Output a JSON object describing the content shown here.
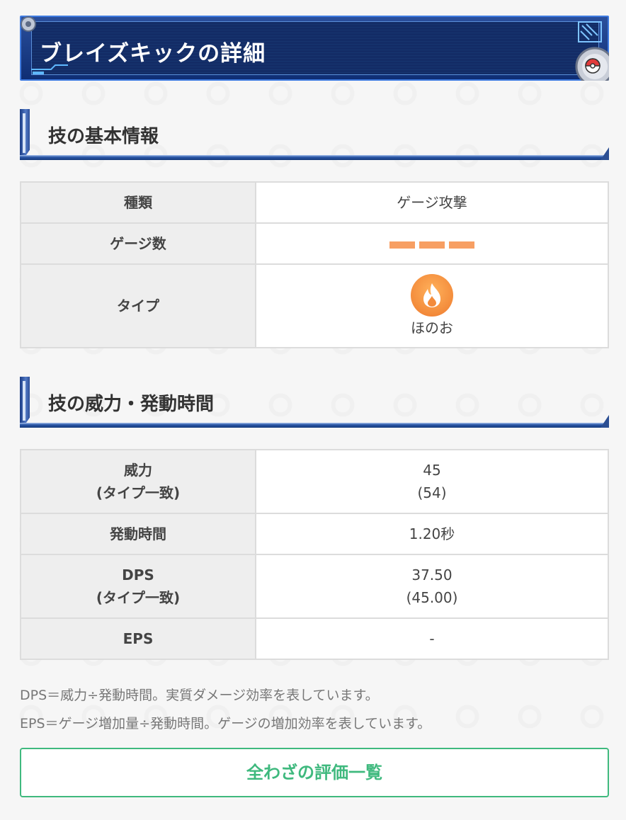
{
  "page_title": "ブレイズキックの詳細",
  "sections": {
    "basic": {
      "heading": "技の基本情報",
      "rows": {
        "kind_label": "種類",
        "kind_value": "ゲージ攻撃",
        "gauge_label": "ゲージ数",
        "gauge_count": 3,
        "gauge_color": "#f79f63",
        "type_label": "タイプ",
        "type_icon": "fire-icon",
        "type_value": "ほのお"
      }
    },
    "power": {
      "heading": "技の威力・発動時間",
      "rows": {
        "power_label_1": "威力",
        "power_label_2": "(タイプ一致)",
        "power_value_1": "45",
        "power_value_2": "(54)",
        "time_label": "発動時間",
        "time_value": "1.20秒",
        "dps_label_1": "DPS",
        "dps_label_2": "(タイプ一致)",
        "dps_value_1": "37.50",
        "dps_value_2": "(45.00)",
        "eps_label": "EPS",
        "eps_value": "-"
      }
    }
  },
  "notes": {
    "line1": "DPS＝威力÷発動時間。実質ダメージ効率を表しています。",
    "line2": "EPS＝ゲージ増加量÷発動時間。ゲージの増加効率を表しています。"
  },
  "all_moves_button": "全わざの評価一覧",
  "colors": {
    "accent_green": "#3fb97e",
    "banner_blue": "#0f2e74",
    "fire_orange": "#f38b3b"
  }
}
